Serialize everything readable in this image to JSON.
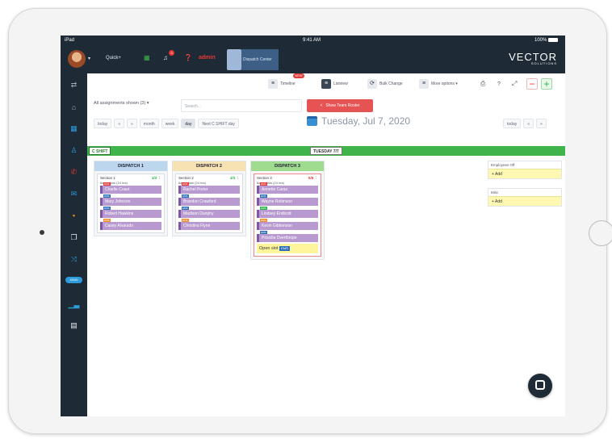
{
  "statusbar": {
    "left": "iPad",
    "time": "9:41 AM",
    "battery": "100%"
  },
  "topnav": {
    "quick_label": "Quick+",
    "notif_count": "3",
    "brand": "admin",
    "dispatch_center_label": "Dispatch Center",
    "vector_brand": "VECTOR",
    "vector_sub": "SOLUTIONS"
  },
  "sidebar": {
    "badge": "40/40"
  },
  "toolbar": {
    "timeline": "Timeline",
    "timeline_badge": "NEW",
    "listview": "Listview",
    "bulk_change": "Bulk Change",
    "more_options": "More options ▾",
    "print_icon": "⎙",
    "help_icon": "?",
    "expand_icon": "⤢",
    "minus": "−",
    "plus": "+"
  },
  "filter": {
    "assignments": "All assignments shown (3) ▾",
    "search_placeholder": "Search...",
    "team_roster": "Show Team Roster"
  },
  "navrow": {
    "today": "today",
    "prev": "«",
    "next": "»",
    "month": "month",
    "week": "week",
    "day": "day",
    "next_shift": "Next C SHIFT day",
    "date": "Tuesday, Jul 7, 2020",
    "today_right": "today",
    "prev_right": "«",
    "next_right": "»"
  },
  "shift": {
    "label": "C SHIFT",
    "date": "TUESDAY 7/7"
  },
  "columns": [
    {
      "title": "DISPATCH 1",
      "color": "#bcd6ee",
      "section": "Section 1",
      "ratio": "4/3",
      "hours": "6am - 6am (24 hrs)",
      "people": [
        {
          "name": "Charlie Coast",
          "tag": "EMS",
          "tag_color": "red"
        },
        {
          "name": "Mary Johnson",
          "tag": "EMS",
          "tag_color": "blue"
        },
        {
          "name": "Robert Hawkins",
          "tag": "EMS",
          "tag_color": "blue"
        },
        {
          "name": "Casey Alvarado",
          "tag": "EMS",
          "tag_color": "orange"
        }
      ]
    },
    {
      "title": "DISPATCH 2",
      "color": "#f6e2b3",
      "section": "Section 2",
      "ratio": "4/3",
      "hours": "6am - 6am (24 hrs)",
      "people": [
        {
          "name": "Rachel Porter",
          "tag": "EMS",
          "tag_color": "red"
        },
        {
          "name": "Brandon Crawford",
          "tag": "EMS",
          "tag_color": "blue"
        },
        {
          "name": "Madison Dunphy",
          "tag": "EMS",
          "tag_color": "blue"
        },
        {
          "name": "Christina Flynn",
          "tag": "EMS",
          "tag_color": "orange"
        }
      ]
    },
    {
      "title": "DISPATCH 3",
      "color": "#9fdc8f",
      "section": "Section 3",
      "ratio": "5/6",
      "hours": "6am - 6am (24 hrs)",
      "people": [
        {
          "name": "Annette Caras",
          "tag": "EMS",
          "tag_color": "red"
        },
        {
          "name": "Wayne Robinson",
          "tag": "EMS",
          "tag_color": "blue"
        },
        {
          "name": "Lindsey Endicott",
          "tag": "EMS",
          "tag_color": "green"
        },
        {
          "name": "Kevin Gibbonson",
          "tag": "EMS",
          "tag_color": "orange"
        },
        {
          "name": "Priscilla Overthrope",
          "tag": "EMS",
          "tag_color": "blue"
        }
      ],
      "open_slot": "Open slot",
      "open_slot_tag": "EMS"
    }
  ],
  "right_panels": [
    {
      "title": "Employees Off",
      "add": "+ Add"
    },
    {
      "title": "Misc",
      "add": "+ Add"
    }
  ]
}
